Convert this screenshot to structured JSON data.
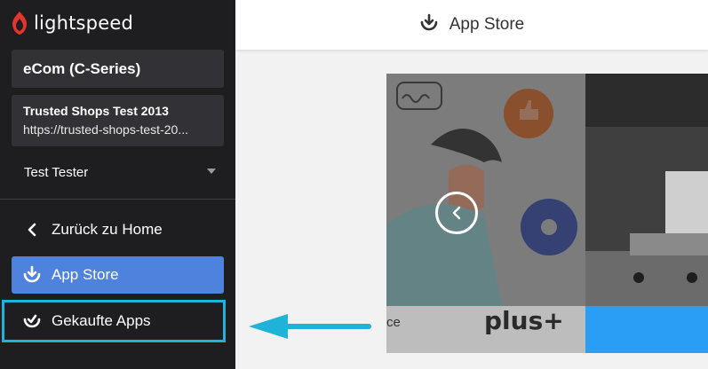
{
  "sidebar": {
    "logo_text": "lightspeed",
    "store_name": "eCom (C-Series)",
    "shop": {
      "title": "Trusted Shops Test 2013",
      "url": "https://trusted-shops-test-20..."
    },
    "user_name": "Test Tester",
    "nav": {
      "back_label": "Zurück zu Home",
      "appstore_label": "App Store",
      "purchased_label": "Gekaufte Apps"
    }
  },
  "header": {
    "title": "App Store"
  },
  "carousel": {
    "banner_plus_text": "plus+",
    "banner_partial_text": "ce"
  },
  "colors": {
    "sidebar_bg": "#1e1e21",
    "active_nav": "#4e82dd",
    "highlight_border": "#1eb3d7",
    "brand_red": "#e4342c"
  },
  "icons": {
    "logo": "flame-icon",
    "back": "chevron-left-icon",
    "appstore": "download-tray-icon",
    "purchased": "check-tray-icon",
    "dropdown": "caret-down-icon",
    "carousel_prev": "chevron-left-circle-icon",
    "annotation": "arrow-left-icon"
  }
}
